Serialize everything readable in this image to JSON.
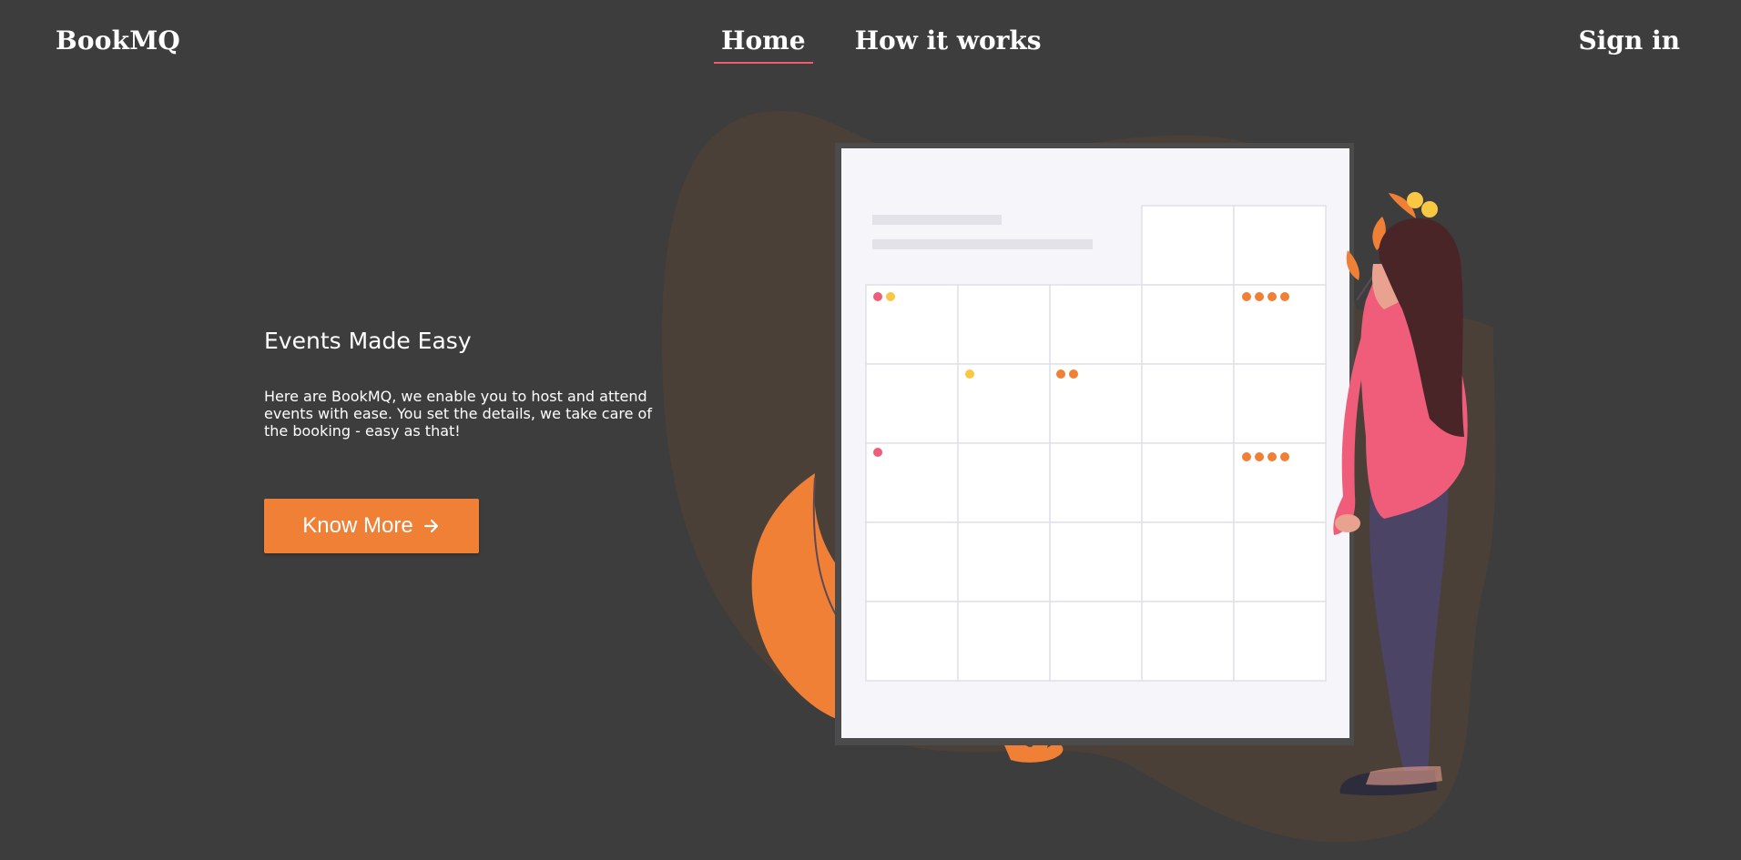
{
  "header": {
    "brand": "BookMQ",
    "nav": [
      {
        "label": "Home",
        "active": true
      },
      {
        "label": "How it works",
        "active": false
      }
    ],
    "sign_in": "Sign in"
  },
  "hero": {
    "title": "Events Made Easy",
    "description": "Here are BookMQ, we enable you to host and attend events with ease. You set the details, we take care of the booking - easy as that!",
    "button_label": "Know More",
    "button_icon": "arrow-right-icon"
  },
  "colors": {
    "background": "#3d3d3d",
    "accent": "#ef8036",
    "nav_underline": "#ef5d6c",
    "blob": "#4a4038",
    "calendar_board": "#f5f5fa",
    "dot_pink": "#ef5d7a",
    "dot_yellow": "#f8c844",
    "dot_orange": "#ef8036"
  }
}
